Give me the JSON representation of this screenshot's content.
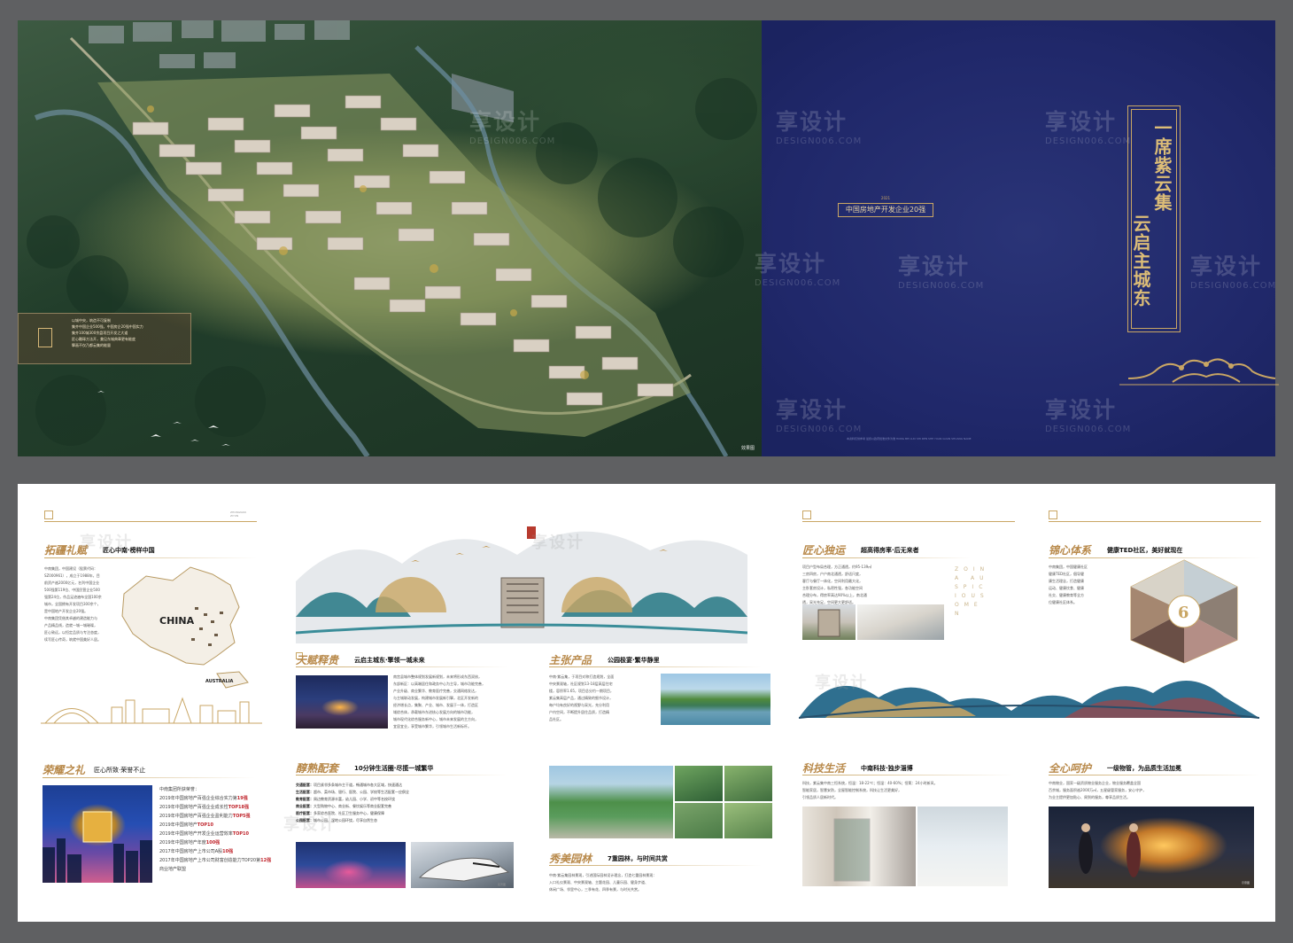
{
  "top_spread": {
    "aerial_info": {
      "lines": [
        "以城中央，筑造不可复制",
        "集齐中国企业500强，中国房企20强中国实力",
        "集齐100城300余盘项目开发之大道",
        "匠心雕琢方法开，兼见东城典章更有能度",
        "擘画不仅乃都云集的能量"
      ]
    },
    "aerial_caption": "效果图",
    "cover": {
      "badge_top": "2021",
      "badge": "中国房地产开发企业20强",
      "slogan_line1": "一席紫云集",
      "slogan_line2": "云启主城东",
      "foot": "本资料仅供参考 最终以政府批准文件为准 HONG BEI LUO SHI REN SHE YUAN GUAN SHUANG NANE"
    },
    "watermarks": [
      {
        "text": "享设计",
        "sub": "DESIGN006.COM"
      }
    ]
  },
  "bottom_spread": {
    "p1": {
      "brand_tag": "ZHONGNAN\nZIYUN",
      "title": "拓疆礼赋",
      "subtitle": "匠心中南·榜样中国",
      "para": [
        "中南集团，中国建设（股票代码：",
        "SZ000961），成立于1988年，目",
        "前资产逾2000亿元，名列中国企业",
        "500强第119位、中国民营企业500",
        "强第24位，作品足迹遍布全国100余",
        "城市，全国拥有开发项目300余个，",
        "是中国地产开发企业20强。",
        "",
        "中南集团凭借其卓越的建造能力与",
        "产品精品线，造就一城一城璀璨，",
        "匠心致远，以恒定品质与专注态度，",
        "续写匠心传奇，筑就中国美好人居。"
      ],
      "map_label": "CHINA",
      "map_label2": "AUSTRALIA",
      "title2": "荣耀之礼",
      "subtitle2": "匠心所致·荣誉不止",
      "honors_intro": "中南集团所获荣誉：",
      "honors": [
        {
          "pre": "2019年中国房地产百强企业综合实力第",
          "num": "19强"
        },
        {
          "pre": "2019年中国房地产百强企业成长性",
          "num": "TOP18强"
        },
        {
          "pre": "2019年中国房地产百强企业盈利能力",
          "num": "TOP5强"
        },
        {
          "pre": "2019年中国房地产",
          "num": "TOP10"
        },
        {
          "pre": "2019年中国房地产开发企业运营效率",
          "num": "TOP10"
        },
        {
          "pre": "2019年中国房地产年度",
          "num": "100强"
        },
        {
          "pre": "2017年中国房地产上市公司A股",
          "num": "10强"
        },
        {
          "pre": "2017年中国房地产上市公司财富创造能力TOP20第",
          "num": "12强"
        },
        {
          "pre": "商业地产联盟",
          "num": ""
        }
      ]
    },
    "p2": {
      "title1": "天赋释贵",
      "subtitle1": "云启主城东·擎领一城未来",
      "para1": [
        "南宫县城市整体规划发展新规划，未来将形成东西双核，",
        "东部新区：以高端居住和政务中心为主导，城市功能完善，",
        "产业升级、商业繁华、教育医疗完善，交通网络发达，",
        "与主城联动发展，构建城市发展新引擎，北区开发新的",
        "经济增长点，集聚、产业、城市、发展于一体，打造区",
        "域综合体，承载城市东进核心发展方向的城市功能，",
        "城市现代化综合服务新中心，城市未来发展的主方向，",
        "宜居宜业，享受城市繁华，引领城市生活新标杆。"
      ],
      "title2": "主张产品",
      "subtitle2": "公园极宴·繁华静里",
      "para2": [
        "中南·紫云集，于项目对称打造规划，全面",
        "中央景观轴，社区规划13-18层高层住宅",
        "楼，容积率1.65，项目总分约一期项目，",
        "紫云集高层产品，通过精致的细节设计，",
        "每户均有良好的视野与采光，充分利用",
        "户内空间，不断提升居住品质，打造精",
        "品社区。"
      ],
      "title3": "醇熟配套",
      "subtitle3": "10分钟生活圈·尽揽一城繁华",
      "amenities": [
        {
          "k": "交通配套：",
          "v": "项目紧邻多条城市主干道，畅通城市各大区域，快速通达"
        },
        {
          "k": "生活配套：",
          "v": "超市、菜市场、银行、医院、公园、学校等生活配套一应俱全"
        },
        {
          "k": "教育配套：",
          "v": "周边教育资源丰富，幼儿园、小学、初中等名校环绕"
        },
        {
          "k": "商业配套：",
          "v": "大型购物中心、商业街、餐饮娱乐等商业配套完善"
        },
        {
          "k": "医疗配套：",
          "v": "多家综合医院、社区卫生服务中心，健康保障"
        },
        {
          "k": "公园配套：",
          "v": "城市公园、湿地公园环绕，尽享自然生态"
        }
      ],
      "title4": "秀美园林",
      "subtitle4": "7重园林，与时间共赏",
      "para4": [
        "中南·紫云集园林景观，引进国际园林设计理念，打造七重园林景观：",
        "入口礼仪景观、中央景观轴、主题花园、儿童乐园、健身步道、",
        "休闲广场、邻里中心，三季有花、四季有景，与时光共赏。"
      ],
      "photo_tag": "实景图"
    },
    "p4": {
      "title1": "匠心独运",
      "subtitle1": "超高得房率·后无来者",
      "para1": [
        "项目户型布局合理，方正通透，约95-139㎡",
        "三房四房，户户南北通透，舒适尺度，",
        "客厅与餐厅一体化，空间利用最大化，",
        "主卧套房设计，私密性强，各功能空间",
        "合理分布，得房率高达90%以上，南北通",
        "透，采光充足，空间更大更舒适。"
      ],
      "vertical_en": "ZOINA AUSPICIOUS OMEN",
      "title2": "锦心体系",
      "subtitle2": "健康TED社区，美好就现在",
      "para2": [
        "中南集团，中国健康社区",
        "健康TED社区，倡导健",
        "康生活理念，打造健康",
        "运动、健康饮食、健康",
        "社交、健康教育等全方",
        "位健康社区体系。"
      ],
      "hex_center": "6",
      "title3": "科技生活",
      "subtitle3": "中南科技·独步淄博",
      "para3": [
        "科技，紫云集中南三恒系统，恒温：18-22℃；恒湿：40-60%；恒氧：24小时新风，",
        "智能家居，智慧安防，全屋智能控制系统，科技让生活更美好，",
        "引领品质人居新时代。"
      ],
      "title4": "全心呵护",
      "subtitle4": "一级物管，为品质生活加冕",
      "para4": [
        "中南物业，国家一级资质物业服务企业，物业服务覆盖全国",
        "百余城，服务面积逾2000万㎡，五星级管家服务，安心守护，",
        "为业主提供更加贴心、周到的服务，尊享品质生活。"
      ],
      "photo_tag": "示意图"
    },
    "watermark": "享设计"
  }
}
